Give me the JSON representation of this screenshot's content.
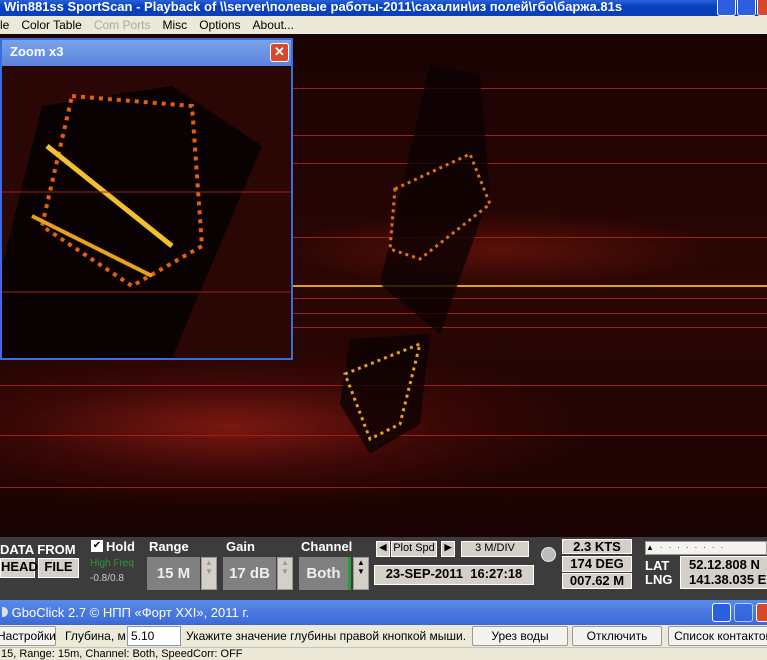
{
  "window": {
    "title": "Win881ss SportScan - Playback of \\\\server\\полевые работы-2011\\сахалин\\из полей\\гбо\\баржа.81s"
  },
  "menu": [
    "le",
    "Color Table",
    "Com Ports",
    "Misc",
    "Options",
    "About..."
  ],
  "zoom_window": {
    "title": "Zoom x3"
  },
  "controls": {
    "data_from": "DATA FROM",
    "head": "HEAD",
    "file": "FILE",
    "hold": "Hold",
    "hold_checked": true,
    "freq": "High Freq",
    "freq_range": "-0.8/0.8",
    "range_label": "Range",
    "range_value": "15 M",
    "gain_label": "Gain",
    "gain_value": "17 dB",
    "channel_label": "Channel",
    "channel_value": "Both",
    "plot_spd": "Plot Spd",
    "scale": "3 M/DIV",
    "datetime": "23-SEP-2011  16:27:18",
    "speed": "2.3 KTS",
    "heading": "174 DEG",
    "depth": "007.62 M",
    "lat_label": "LAT",
    "lng_label": "LNG",
    "lat": "52.12.808 N",
    "lng": "141.38.035 E"
  },
  "gbo": {
    "title": "GboClick 2.7 © НПП «Форт XXI», 2011 г.",
    "settings": "Настройки",
    "depth_label": "Глубина, м",
    "depth_value": "5.10",
    "hint": "Укажите значение глубины правой кнопкой мыши.",
    "waterline": "Урез воды",
    "disconnect": "Отключить",
    "contacts": "Список контактов"
  },
  "status": "15, Range: 15m, Channel: Both, SpeedCorr: OFF",
  "colors": {
    "sonar_line": "#a02020",
    "track_line": "#e0a020",
    "panel": "#3c3c3c"
  }
}
